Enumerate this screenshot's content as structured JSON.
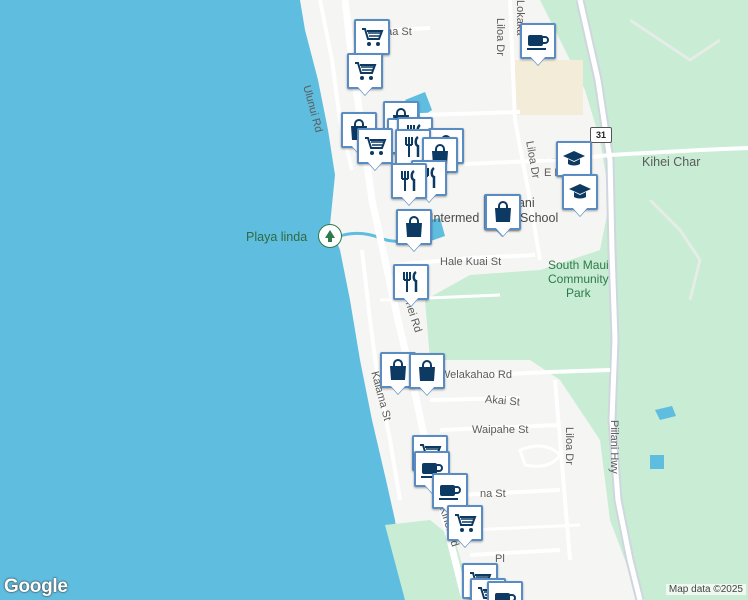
{
  "labels": {
    "kihei_charter": "Kihei Char",
    "playa_linda": "Playa linda",
    "intermediate_school": "Intermed",
    "school_suffix": "School",
    "lokelani": "kelani",
    "park": "South Maui\nCommunity\nPark",
    "hwy_shield": "31",
    "map_data": "Map data ©2025",
    "google": "Google"
  },
  "streets": {
    "s1": "haa St",
    "s2": "Ulunui Rd",
    "s3": "Liloa Dr",
    "s4": "Liloa Dr",
    "s5": "E L",
    "s6": "Hale Kuai St",
    "s7": "hei Rd",
    "s8": "Welakahao Rd",
    "s9": "Kalama St",
    "s10": "Akai St",
    "s11": "Waipahe St",
    "s12": "Liloa Dr",
    "s13": "Piilani Hwy",
    "s14": "na St",
    "s15": "Kihei Rd",
    "s16": "Pl",
    "s17": "Lokaka"
  },
  "colors": {
    "water": "#5fbde0",
    "land": "#f5f5f3",
    "park": "#c8ecd4",
    "road": "#ffffff",
    "highway": "#cfd6df",
    "school_area": "#f3ecd9",
    "marker_border": "#5a8cc4",
    "marker_icon": "#0d3a63"
  },
  "markers": [
    {
      "name": "cart",
      "icon": "cart-icon"
    },
    {
      "name": "coffee",
      "icon": "coffee-icon"
    },
    {
      "name": "cart",
      "icon": "cart-icon"
    },
    {
      "name": "shop",
      "icon": "shopping-bag-icon"
    },
    {
      "name": "shop",
      "icon": "shopping-bag-icon"
    },
    {
      "name": "restaurant",
      "icon": "restaurant-icon"
    },
    {
      "name": "restaurant",
      "icon": "restaurant-icon"
    },
    {
      "name": "shop",
      "icon": "shopping-bag-icon"
    },
    {
      "name": "cart",
      "icon": "cart-icon"
    },
    {
      "name": "restaurant",
      "icon": "restaurant-icon"
    },
    {
      "name": "shop",
      "icon": "shopping-bag-icon"
    },
    {
      "name": "restaurant",
      "icon": "restaurant-icon"
    },
    {
      "name": "shop",
      "icon": "shopping-bag-icon"
    },
    {
      "name": "restaurant",
      "icon": "restaurant-icon"
    },
    {
      "name": "school",
      "icon": "graduation-cap-icon"
    },
    {
      "name": "school",
      "icon": "graduation-cap-icon"
    },
    {
      "name": "shop",
      "icon": "shopping-bag-icon"
    },
    {
      "name": "shop",
      "icon": "shopping-bag-icon"
    },
    {
      "name": "restaurant",
      "icon": "restaurant-icon"
    },
    {
      "name": "shop",
      "icon": "shopping-bag-icon"
    },
    {
      "name": "shop",
      "icon": "shopping-bag-icon"
    },
    {
      "name": "cart",
      "icon": "cart-icon"
    },
    {
      "name": "coffee",
      "icon": "coffee-icon"
    },
    {
      "name": "coffee",
      "icon": "coffee-icon"
    },
    {
      "name": "cart",
      "icon": "cart-icon"
    },
    {
      "name": "cart",
      "icon": "cart-icon"
    },
    {
      "name": "cart",
      "icon": "cart-icon"
    },
    {
      "name": "coffee",
      "icon": "coffee-icon"
    }
  ]
}
